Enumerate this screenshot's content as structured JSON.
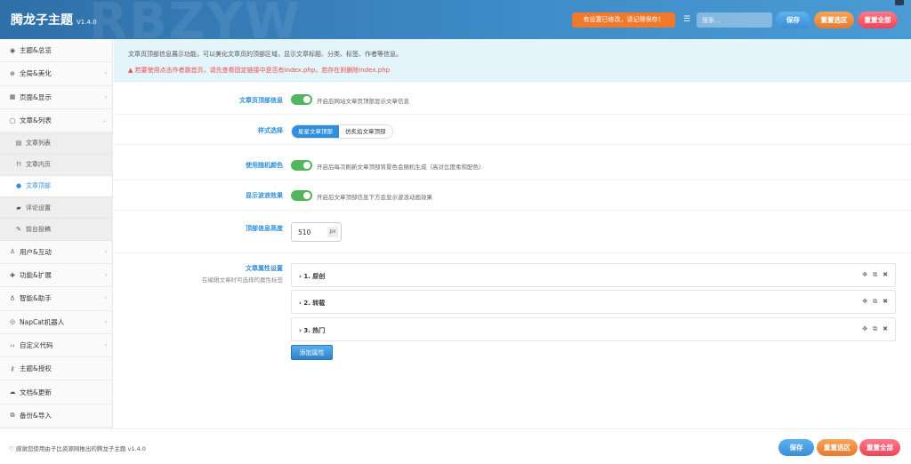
{
  "header": {
    "watermark": "RBZYW",
    "title": "腾龙子主题",
    "version": "V1.4.0",
    "notice": "有设置已修改，请记得保存！",
    "search_placeholder": "搜索...",
    "save_label": "保存",
    "reset_section_label": "重置选区",
    "reset_all_label": "重置全部"
  },
  "sidebar": {
    "items": [
      {
        "label": "主题&总览",
        "icon": "dashboard-icon"
      },
      {
        "label": "全局&美化",
        "icon": "globe-icon"
      },
      {
        "label": "页面&显示",
        "icon": "calendar-icon"
      },
      {
        "label": "文章&列表",
        "icon": "map-icon"
      },
      {
        "label": "用户&互动",
        "icon": "user-icon"
      },
      {
        "label": "功能&扩展",
        "icon": "puzzle-icon"
      },
      {
        "label": "智能&助手",
        "icon": "lightbulb-icon"
      },
      {
        "label": "NapCat机器人",
        "icon": "robot-icon"
      },
      {
        "label": "自定义代码",
        "icon": "code-icon"
      },
      {
        "label": "主题&授权",
        "icon": "key-icon"
      },
      {
        "label": "文档&更新",
        "icon": "cloud-icon"
      },
      {
        "label": "备份&导入",
        "icon": "copy-icon"
      }
    ],
    "subitems": [
      {
        "label": "文章列表",
        "icon": "file-icon"
      },
      {
        "label": "文章内页",
        "icon": "bookmark-icon"
      },
      {
        "label": "文章顶部",
        "icon": "info-circle-icon"
      },
      {
        "label": "评论设置",
        "icon": "comments-icon"
      },
      {
        "label": "前台投稿",
        "icon": "pen-icon"
      }
    ]
  },
  "main": {
    "info_line1": "文章页顶部信息展示功能，可以美化文章页的顶部区域，显示文章标题、分类、标签、作者等信息。",
    "info_line2": "▲ 若要使用点击作者跳首页，请先查看固定链接中是否有index.php，若存在则删除index.php",
    "settings": {
      "top_info": {
        "label": "文章页顶部信息",
        "desc": "开启后网站文章页顶部显示文章信息"
      },
      "style": {
        "label": "样式选择",
        "options": [
          "星星文章顶部",
          "仿炙焰文章顶部"
        ]
      },
      "random_color": {
        "label": "使用随机颜色",
        "desc": "开启后每次刷新文章顶部背景色会随机生成（高对比度柔和配色）"
      },
      "wave": {
        "label": "显示波浪效果",
        "desc": "开启后文章顶部信息下方会显示波浪动画效果"
      },
      "height": {
        "label": "顶部信息高度",
        "value": "510",
        "unit": "px"
      },
      "attributes": {
        "label": "文章属性设置",
        "sublabel": "在编辑文章时可选择的属性标签",
        "groups": [
          "1. 原创",
          "2. 转载",
          "3. 热门"
        ],
        "add_label": "添加属性"
      }
    }
  },
  "footer": {
    "credit": "♡ 感谢您使用由子比资源网推出的腾龙子主题 v1.4.0",
    "save_label": "保存",
    "reset_section_label": "重置选区",
    "reset_all_label": "重置全部"
  }
}
